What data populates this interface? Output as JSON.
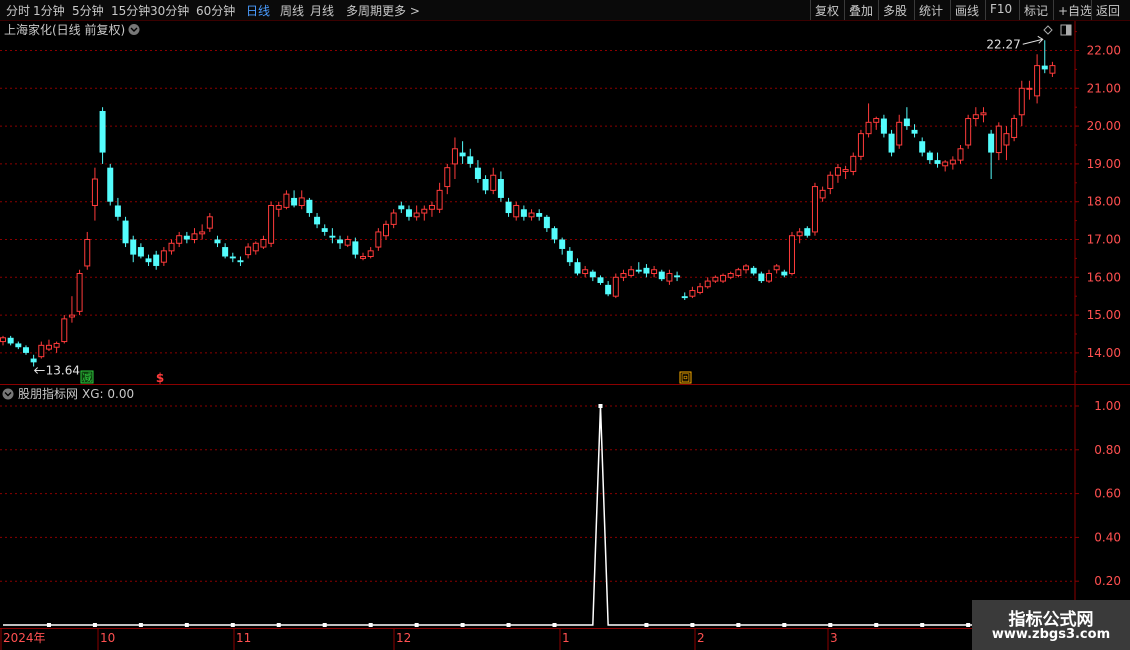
{
  "toolbar": {
    "periods": [
      "分时",
      "1分钟",
      "5分钟",
      "15分钟",
      "30分钟",
      "60分钟",
      "日线",
      "周线",
      "月线",
      "多周期",
      "更多 >"
    ],
    "active_period": "日线",
    "right_buttons": [
      "复权",
      "叠加",
      "多股",
      "统计",
      "画线",
      "F10",
      "标记",
      "+自选",
      "返回"
    ]
  },
  "main_panel": {
    "title": "上海家化(日线 前复权)",
    "y_ticks": [
      "22.00",
      "21.00",
      "20.00",
      "19.00",
      "18.00",
      "17.00",
      "16.00",
      "15.00",
      "14.00"
    ],
    "max_label": "22.27",
    "min_label": "13.64",
    "signals": [
      "减",
      "$",
      "回"
    ]
  },
  "indicator_panel": {
    "title": "股朋指标网",
    "value_label": "XG: 0.00",
    "y_ticks": [
      "1.00",
      "0.80",
      "0.60",
      "0.40",
      "0.20"
    ]
  },
  "x_axis": {
    "labels": [
      "2024年",
      "10",
      "11",
      "12",
      "1",
      "2",
      "3"
    ]
  },
  "watermark": {
    "line1": "指标公式网",
    "line2": "www.zbgs3.com"
  },
  "colors": {
    "up": "#ff3b3b",
    "down": "#54fcfc",
    "grid": "#8b0000",
    "axis_text": "#ff5050",
    "title_text": "#c8c8c8",
    "indicator_line": "#ffffff",
    "signal_green": "#2ecc40",
    "signal_red": "#ff3b3b",
    "signal_orange": "#ffb000"
  },
  "chart_data": [
    {
      "type": "candlestick",
      "title": "上海家化(日线 前复权)",
      "x_labels": [
        "2024年",
        "10",
        "11",
        "12",
        "1",
        "2",
        "3"
      ],
      "y_range": [
        13.5,
        22.5
      ],
      "candles_ohlc": [
        [
          14.3,
          14.45,
          14.2,
          14.4
        ],
        [
          14.4,
          14.45,
          14.2,
          14.25
        ],
        [
          14.25,
          14.3,
          14.1,
          14.15
        ],
        [
          14.15,
          14.2,
          13.95,
          14.0
        ],
        [
          13.85,
          13.95,
          13.64,
          13.75
        ],
        [
          13.9,
          14.3,
          13.85,
          14.2
        ],
        [
          14.1,
          14.35,
          14.05,
          14.2
        ],
        [
          14.15,
          14.3,
          14.0,
          14.25
        ],
        [
          14.3,
          15.0,
          14.25,
          14.9
        ],
        [
          14.95,
          15.5,
          14.8,
          15.0
        ],
        [
          15.1,
          16.2,
          15.0,
          16.1
        ],
        [
          16.3,
          17.2,
          16.2,
          17.0
        ],
        [
          17.9,
          18.9,
          17.5,
          18.6
        ],
        [
          20.4,
          20.5,
          19.0,
          19.3
        ],
        [
          18.9,
          19.0,
          17.9,
          18.0
        ],
        [
          17.9,
          18.1,
          17.5,
          17.6
        ],
        [
          17.5,
          17.6,
          16.8,
          16.9
        ],
        [
          17.0,
          17.1,
          16.4,
          16.6
        ],
        [
          16.8,
          16.9,
          16.5,
          16.55
        ],
        [
          16.5,
          16.6,
          16.3,
          16.4
        ],
        [
          16.6,
          16.7,
          16.2,
          16.3
        ],
        [
          16.4,
          16.8,
          16.3,
          16.7
        ],
        [
          16.7,
          17.0,
          16.6,
          16.9
        ],
        [
          16.9,
          17.2,
          16.8,
          17.1
        ],
        [
          17.1,
          17.2,
          16.9,
          17.0
        ],
        [
          17.0,
          17.3,
          16.9,
          17.15
        ],
        [
          17.15,
          17.4,
          17.0,
          17.2
        ],
        [
          17.3,
          17.7,
          17.2,
          17.6
        ],
        [
          17.0,
          17.1,
          16.8,
          16.9
        ],
        [
          16.8,
          16.9,
          16.5,
          16.55
        ],
        [
          16.55,
          16.65,
          16.4,
          16.5
        ],
        [
          16.45,
          16.55,
          16.3,
          16.4
        ],
        [
          16.6,
          16.9,
          16.5,
          16.8
        ],
        [
          16.7,
          16.95,
          16.6,
          16.9
        ],
        [
          16.8,
          17.1,
          16.75,
          17.0
        ],
        [
          16.9,
          18.0,
          16.8,
          17.9
        ],
        [
          17.8,
          18.0,
          17.6,
          17.9
        ],
        [
          17.85,
          18.3,
          17.8,
          18.2
        ],
        [
          18.1,
          18.3,
          17.85,
          17.9
        ],
        [
          17.9,
          18.3,
          17.8,
          18.1
        ],
        [
          18.05,
          18.1,
          17.6,
          17.7
        ],
        [
          17.6,
          17.7,
          17.3,
          17.4
        ],
        [
          17.3,
          17.4,
          17.1,
          17.2
        ],
        [
          17.1,
          17.3,
          16.9,
          17.05
        ],
        [
          17.0,
          17.1,
          16.75,
          16.9
        ],
        [
          16.85,
          17.1,
          16.8,
          17.0
        ],
        [
          16.95,
          17.05,
          16.5,
          16.6
        ],
        [
          16.5,
          16.65,
          16.45,
          16.55
        ],
        [
          16.55,
          16.8,
          16.5,
          16.7
        ],
        [
          16.8,
          17.3,
          16.7,
          17.2
        ],
        [
          17.1,
          17.5,
          17.0,
          17.4
        ],
        [
          17.4,
          17.8,
          17.3,
          17.7
        ],
        [
          17.9,
          18.0,
          17.7,
          17.8
        ],
        [
          17.8,
          17.9,
          17.5,
          17.6
        ],
        [
          17.6,
          17.9,
          17.5,
          17.7
        ],
        [
          17.7,
          17.9,
          17.5,
          17.8
        ],
        [
          17.8,
          18.0,
          17.6,
          17.9
        ],
        [
          17.8,
          18.5,
          17.7,
          18.3
        ],
        [
          18.4,
          19.0,
          18.2,
          18.9
        ],
        [
          19.0,
          19.7,
          18.6,
          19.4
        ],
        [
          19.3,
          19.6,
          19.0,
          19.2
        ],
        [
          19.2,
          19.4,
          18.9,
          19.0
        ],
        [
          18.9,
          19.1,
          18.5,
          18.6
        ],
        [
          18.6,
          18.7,
          18.2,
          18.3
        ],
        [
          18.3,
          18.9,
          18.2,
          18.7
        ],
        [
          18.6,
          18.8,
          18.0,
          18.1
        ],
        [
          18.0,
          18.1,
          17.6,
          17.7
        ],
        [
          17.6,
          18.0,
          17.5,
          17.9
        ],
        [
          17.8,
          17.9,
          17.5,
          17.6
        ],
        [
          17.6,
          17.8,
          17.5,
          17.7
        ],
        [
          17.7,
          17.8,
          17.5,
          17.6
        ],
        [
          17.6,
          17.65,
          17.2,
          17.3
        ],
        [
          17.3,
          17.35,
          16.9,
          17.0
        ],
        [
          17.0,
          17.05,
          16.6,
          16.75
        ],
        [
          16.7,
          16.8,
          16.3,
          16.4
        ],
        [
          16.4,
          16.5,
          16.05,
          16.1
        ],
        [
          16.1,
          16.3,
          16.0,
          16.2
        ],
        [
          16.15,
          16.2,
          15.9,
          16.0
        ],
        [
          16.0,
          16.05,
          15.8,
          15.85
        ],
        [
          15.8,
          15.9,
          15.5,
          15.55
        ],
        [
          15.5,
          16.1,
          15.45,
          16.0
        ],
        [
          16.0,
          16.2,
          15.9,
          16.1
        ],
        [
          16.05,
          16.3,
          16.0,
          16.2
        ],
        [
          16.2,
          16.4,
          16.1,
          16.15
        ],
        [
          16.25,
          16.35,
          16.0,
          16.1
        ],
        [
          16.1,
          16.3,
          16.0,
          16.2
        ],
        [
          16.15,
          16.2,
          15.9,
          15.95
        ],
        [
          15.9,
          16.2,
          15.8,
          16.1
        ],
        [
          16.05,
          16.15,
          15.9,
          16.0
        ],
        [
          15.5,
          15.6,
          15.4,
          15.45
        ],
        [
          15.5,
          15.75,
          15.45,
          15.65
        ],
        [
          15.6,
          15.85,
          15.55,
          15.75
        ],
        [
          15.75,
          16.0,
          15.7,
          15.9
        ],
        [
          15.9,
          16.05,
          15.85,
          16.0
        ],
        [
          15.9,
          16.1,
          15.85,
          16.05
        ],
        [
          16.0,
          16.15,
          15.95,
          16.1
        ],
        [
          16.05,
          16.25,
          16.0,
          16.2
        ],
        [
          16.2,
          16.35,
          16.1,
          16.3
        ],
        [
          16.25,
          16.3,
          16.05,
          16.1
        ],
        [
          16.1,
          16.15,
          15.85,
          15.9
        ],
        [
          15.9,
          16.2,
          15.85,
          16.1
        ],
        [
          16.2,
          16.35,
          16.1,
          16.3
        ],
        [
          16.15,
          16.2,
          16.0,
          16.05
        ],
        [
          16.1,
          17.2,
          16.05,
          17.1
        ],
        [
          17.1,
          17.3,
          16.9,
          17.2
        ],
        [
          17.3,
          17.35,
          17.05,
          17.1
        ],
        [
          17.2,
          18.5,
          17.1,
          18.4
        ],
        [
          18.1,
          18.4,
          18.0,
          18.3
        ],
        [
          18.35,
          18.8,
          18.2,
          18.7
        ],
        [
          18.7,
          19.0,
          18.5,
          18.9
        ],
        [
          18.8,
          18.95,
          18.6,
          18.85
        ],
        [
          18.8,
          19.3,
          18.7,
          19.2
        ],
        [
          19.2,
          19.9,
          19.1,
          19.8
        ],
        [
          19.8,
          20.6,
          19.7,
          20.1
        ],
        [
          20.1,
          20.25,
          19.9,
          20.2
        ],
        [
          20.2,
          20.3,
          19.7,
          19.8
        ],
        [
          19.8,
          19.9,
          19.2,
          19.3
        ],
        [
          19.5,
          20.3,
          19.4,
          20.1
        ],
        [
          20.2,
          20.5,
          19.9,
          20.0
        ],
        [
          19.9,
          20.05,
          19.7,
          19.8
        ],
        [
          19.6,
          19.7,
          19.2,
          19.3
        ],
        [
          19.3,
          19.35,
          19.0,
          19.1
        ],
        [
          19.1,
          19.3,
          18.9,
          19.0
        ],
        [
          18.95,
          19.1,
          18.8,
          19.05
        ],
        [
          19.0,
          19.2,
          18.85,
          19.1
        ],
        [
          19.1,
          19.5,
          19.0,
          19.4
        ],
        [
          19.5,
          20.3,
          19.4,
          20.2
        ],
        [
          20.2,
          20.5,
          20.0,
          20.3
        ],
        [
          20.3,
          20.5,
          20.1,
          20.35
        ],
        [
          19.8,
          19.9,
          18.6,
          19.3
        ],
        [
          19.3,
          20.1,
          19.1,
          20.0
        ],
        [
          19.5,
          20.0,
          19.1,
          19.8
        ],
        [
          19.7,
          20.3,
          19.6,
          20.2
        ],
        [
          20.3,
          21.2,
          20.0,
          21.0
        ],
        [
          21.0,
          21.2,
          20.7,
          21.0
        ],
        [
          20.8,
          21.9,
          20.6,
          21.6
        ],
        [
          21.6,
          22.27,
          21.4,
          21.5
        ],
        [
          21.4,
          21.7,
          21.3,
          21.6
        ]
      ]
    },
    {
      "type": "line",
      "title": "股朋指标网",
      "series": [
        {
          "name": "XG",
          "values_nonzero": [
            {
              "index": 78,
              "value": 1.0
            }
          ],
          "baseline": 0.0
        }
      ],
      "ylim": [
        0,
        1.0
      ]
    }
  ]
}
